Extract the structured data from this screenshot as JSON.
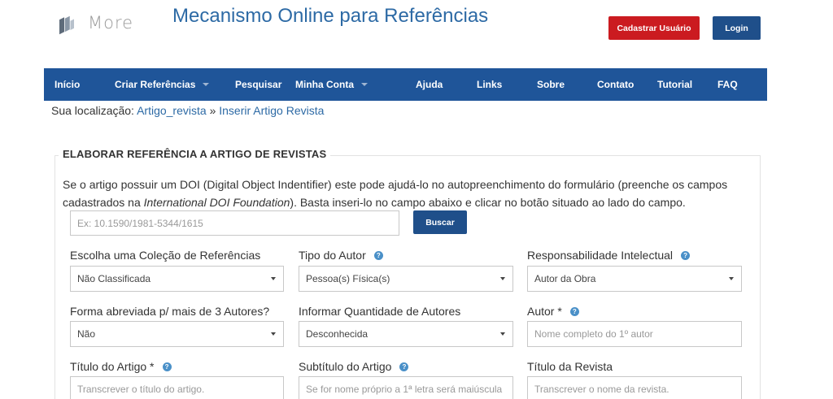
{
  "header": {
    "logo_text": "More",
    "title": "Mecanismo Online para Referências",
    "register_button": "Cadastrar Usuário",
    "login_button": "Login"
  },
  "nav": {
    "items": [
      {
        "label": "Início",
        "icon": ""
      },
      {
        "label": "Criar Referências",
        "icon": "caret-down"
      },
      {
        "label": "Pesquisar",
        "icon": ""
      },
      {
        "label": "Minha Conta",
        "icon": "caret-down"
      },
      {
        "label": "Ajuda",
        "icon": ""
      },
      {
        "label": "Links",
        "icon": ""
      },
      {
        "label": "Sobre",
        "icon": ""
      },
      {
        "label": "Contato",
        "icon": ""
      },
      {
        "label": "Tutorial",
        "icon": ""
      },
      {
        "label": "FAQ",
        "icon": ""
      }
    ]
  },
  "breadcrumb": {
    "prefix": "Sua localização:",
    "link1": "Artigo_revista",
    "separator": "»",
    "link2": "Inserir Artigo Revista"
  },
  "form": {
    "legend": "ELABORAR REFERÊNCIA A ARTIGO DE REVISTAS",
    "intro_part1": "Se o artigo possuir um DOI (Digital Object Indentifier) este pode ajudá-lo no autopreenchimento do formulário (preenche os campos cadastrados na ",
    "intro_italic": "International DOI Foundation",
    "intro_part2": "). Basta inseri-lo no campo abaixo e clicar no botão situado ao lado do campo.",
    "doi_placeholder": "Ex: 10.1590/1981-5344/1615",
    "search_button": "Buscar",
    "fields": {
      "colecao_label": "Escolha uma Coleção de Referências",
      "colecao_value": "Não Classificada",
      "tipo_autor_label": "Tipo do Autor",
      "tipo_autor_value": "Pessoa(s) Física(s)",
      "responsabilidade_label": "Responsabilidade Intelectual",
      "responsabilidade_value": "Autor da Obra",
      "forma_abreviada_label": "Forma abreviada p/ mais de 3 Autores?",
      "forma_abreviada_value": "Não",
      "quantidade_label": "Informar Quantidade de Autores",
      "quantidade_value": "Desconhecida",
      "autor_label": "Autor *",
      "autor_placeholder": "Nome completo do 1º autor",
      "titulo_artigo_label": "Título do Artigo *",
      "titulo_artigo_placeholder": "Transcrever o título do artigo.",
      "subtitulo_label": "Subtítulo do Artigo",
      "subtitulo_placeholder": "Se for nome próprio a 1ª letra será maiúscula",
      "titulo_revista_label": "Título da Revista",
      "titulo_revista_placeholder": "Transcrever o nome da revista."
    }
  },
  "colors": {
    "nav_bg": "#1f5599",
    "title_blue": "#2d6aa5",
    "register_red": "#cb1b20",
    "button_blue": "#1f4f8a",
    "help_icon": "#4a90c8"
  }
}
